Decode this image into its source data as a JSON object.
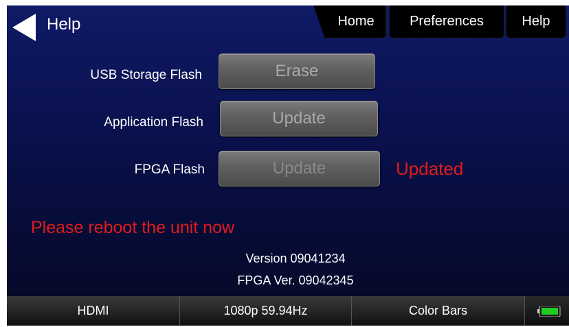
{
  "header": {
    "title": "Help",
    "tabs": [
      {
        "label": "Home"
      },
      {
        "label": "Preferences"
      },
      {
        "label": "Help"
      }
    ]
  },
  "rows": [
    {
      "label": "USB Storage Flash",
      "button": "Erase"
    },
    {
      "label": "Application Flash",
      "button": "Update"
    },
    {
      "label": "FPGA Flash",
      "button": "Update",
      "status": "Updated"
    }
  ],
  "message": "Please reboot the unit now",
  "version": "Version 09041234",
  "fpga_version": "FPGA Ver. 09042345",
  "statusbar": {
    "items": [
      "HDMI",
      "1080p 59.94Hz",
      "Color Bars"
    ]
  },
  "colors": {
    "background_top": "#101a66",
    "alert": "#e21b1b",
    "battery": "#22cc22"
  },
  "icons": {
    "back": "back-arrow-icon",
    "battery": "battery-icon"
  }
}
